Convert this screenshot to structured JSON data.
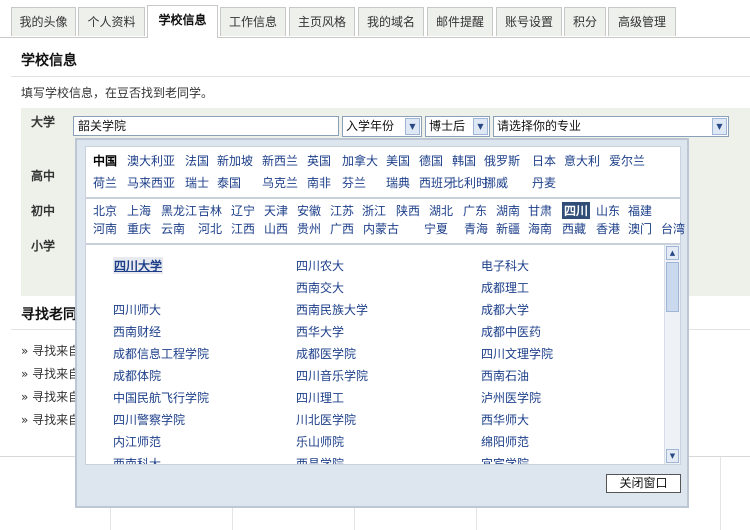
{
  "tabs": [
    "我的头像",
    "个人资料",
    "学校信息",
    "工作信息",
    "主页风格",
    "我的域名",
    "邮件提醒",
    "账号设置",
    "积分",
    "高级管理"
  ],
  "active_tab": "学校信息",
  "page": {
    "title": "学校信息",
    "description": "填写学校信息，在豆否找到老同学。"
  },
  "form": {
    "labels": {
      "university": "大学",
      "highschool": "高中",
      "middleschool": "初中",
      "primary": "小学"
    },
    "university_value": "韶关学院",
    "year_select": "入学年份",
    "degree_select": "博士后",
    "major_select": "请选择你的专业"
  },
  "find_section": {
    "title": "寻找老同",
    "links": [
      "» 寻找来自",
      "» 寻找来自",
      "» 寻找来自",
      "» 寻找来自"
    ]
  },
  "popup": {
    "countries_row1": [
      "中国",
      "澳大利亚",
      "法国",
      "新加坡",
      "新西兰",
      "英国",
      "加拿大",
      "美国",
      "德国",
      "韩国",
      "俄罗斯",
      "日本",
      "意大利",
      "爱尔兰"
    ],
    "countries_row2": [
      "荷兰",
      "马来西亚",
      "瑞士",
      "泰国",
      "乌克兰",
      "南非",
      "芬兰",
      "瑞典",
      "西班牙",
      "比利时",
      "挪威",
      "丹麦"
    ],
    "provinces_row1": [
      "北京",
      "上海",
      "黑龙江",
      "吉林",
      "辽宁",
      "天津",
      "安徽",
      "江苏",
      "浙江",
      "陕西",
      "湖北",
      "广东",
      "湖南",
      "甘肃",
      "四川",
      "山东",
      "福建"
    ],
    "provinces_row2": [
      "河南",
      "重庆",
      "云南",
      "河北",
      "江西",
      "山西",
      "贵州",
      "广西",
      "内蒙古",
      "宁夏",
      "青海",
      "新疆",
      "海南",
      "西藏",
      "香港",
      "澳门",
      "台湾"
    ],
    "selected_country": "中国",
    "selected_province": "四川",
    "universities": [
      [
        "四川大学",
        "四川农大",
        "电子科大"
      ],
      [
        "",
        "西南交大",
        "成都理工"
      ],
      [
        "四川师大",
        "西南民族大学",
        "成都大学"
      ],
      [
        "西南财经",
        "西华大学",
        "成都中医药"
      ],
      [
        "成都信息工程学院",
        "成都医学院",
        "四川文理学院"
      ],
      [
        "成都体院",
        "四川音乐学院",
        "西南石油"
      ],
      [
        "中国民航飞行学院",
        "四川理工",
        "泸州医学院"
      ],
      [
        "四川警察学院",
        "川北医学院",
        "西华师大"
      ],
      [
        "内江师范",
        "乐山师院",
        "绵阳师范"
      ],
      [
        "西南科大",
        "西昌学院",
        "宜宾学院"
      ]
    ],
    "close_label": "关闭窗口"
  }
}
